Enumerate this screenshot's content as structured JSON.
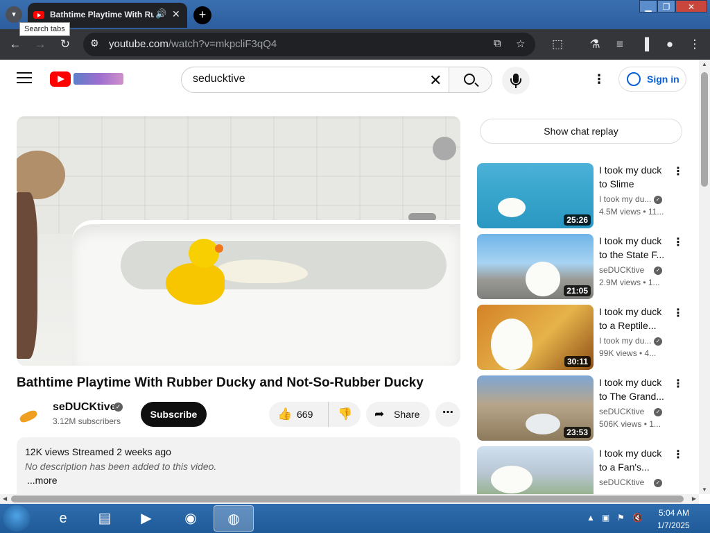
{
  "browser": {
    "tab_title": "Bathtime Playtime With Ru",
    "tooltip": "Search tabs",
    "new_tab": "+",
    "url_domain": "youtube.com",
    "url_path": "/watch?v=mkpcliF3qQ4"
  },
  "youtube": {
    "search_value": "seducktive",
    "signin_label": "Sign in",
    "video_title": "Bathtime Playtime With Rubber Ducky and Not-So-Rubber Ducky",
    "channel_name": "seDUCKtive",
    "channel_subscribers": "3.12M subscribers",
    "subscribe_label": "Subscribe",
    "like_count": "669",
    "share_label": "Share",
    "description": {
      "meta": "12K views  Streamed 2 weeks ago",
      "text": "No description has been added to this video.",
      "more": "...more"
    },
    "chat_replay_label": "Show chat replay",
    "recommendations": [
      {
        "title": "I took my duck to Slime",
        "channel": "I took my du...",
        "views": "4.5M views  • 11...",
        "duration": "25:26"
      },
      {
        "title": "I took my duck to the State F...",
        "channel": "seDUCKtive",
        "views": "2.9M views  • 1...",
        "duration": "21:05"
      },
      {
        "title": "I took my duck to a Reptile...",
        "channel": "I took my du...",
        "views": "99K views  • 4...",
        "duration": "30:11"
      },
      {
        "title": "I took my duck to The Grand...",
        "channel": "seDUCKtive",
        "views": "506K views  • 1...",
        "duration": "23:53"
      },
      {
        "title": "I took my duck to a Fan's...",
        "channel": "seDUCKtive",
        "views": "",
        "duration": ""
      }
    ]
  },
  "taskbar": {
    "time": "5:04 AM",
    "date": "1/7/2025"
  }
}
